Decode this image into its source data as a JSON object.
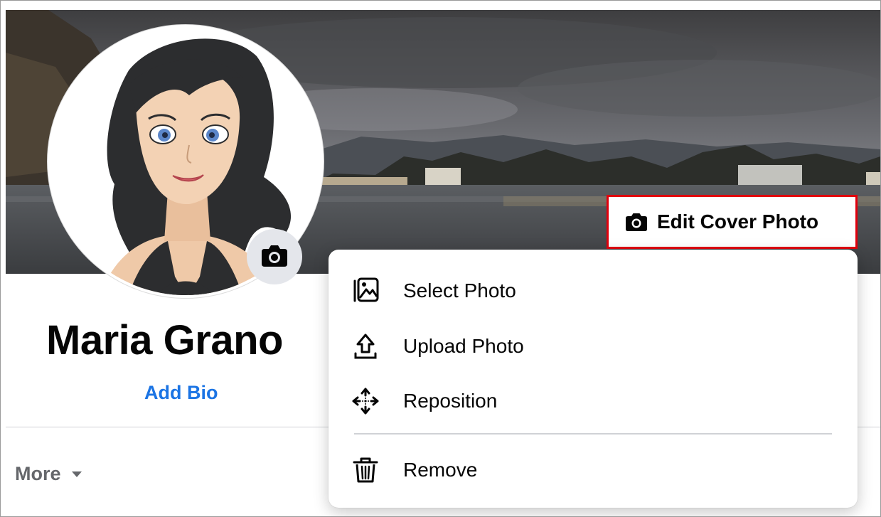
{
  "profile": {
    "name": "Maria Grano",
    "add_bio_label": "Add Bio"
  },
  "cover": {
    "edit_cover_label": "Edit Cover Photo"
  },
  "tabs": {
    "more_label": "More"
  },
  "cover_menu": {
    "items": [
      {
        "label": "Select Photo",
        "icon": "select-photo-icon"
      },
      {
        "label": "Upload Photo",
        "icon": "upload-icon"
      },
      {
        "label": "Reposition",
        "icon": "move-arrows-icon"
      },
      {
        "label": "Remove",
        "icon": "trash-icon"
      }
    ]
  },
  "colors": {
    "accent": "#1b74e4",
    "highlight_border": "#e1000d",
    "secondary_text": "#65676b",
    "icon_bg": "#e4e6eb"
  }
}
